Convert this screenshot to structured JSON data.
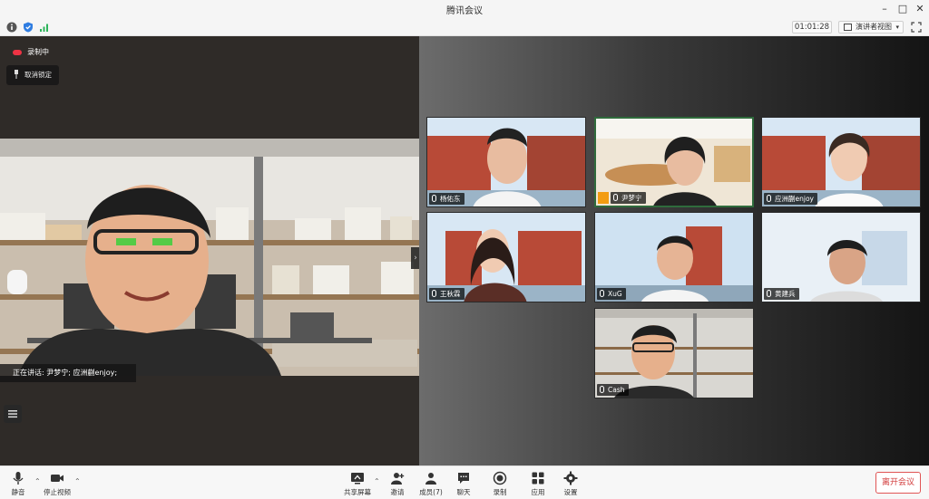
{
  "window": {
    "title": "腾讯会议"
  },
  "infobar": {
    "timer": "01:01:28",
    "view_mode": "演讲者视图"
  },
  "recording": {
    "label": "录制中"
  },
  "unpin": {
    "label": "取消锁定"
  },
  "speaking": {
    "label": "正在讲话: 尹梦宁; 应洲蒯enjoy;"
  },
  "participants": [
    {
      "name": "杨佑东"
    },
    {
      "name": "尹梦宁"
    },
    {
      "name": "应洲蒯enjoy"
    },
    {
      "name": "王秋霖"
    },
    {
      "name": "XuG"
    },
    {
      "name": "黄建兵"
    },
    {
      "name": "Cash"
    }
  ],
  "toolbar": {
    "mute": "静音",
    "stop_video": "停止视频",
    "share": "共享屏幕",
    "invite": "邀请",
    "members": "成员(7)",
    "chat": "聊天",
    "record": "录制",
    "apps": "应用",
    "settings": "设置",
    "leave": "离开会议"
  },
  "colors": {
    "leave": "#d23b3b",
    "active_tile": "#2f6b3c",
    "recording": "#e33344"
  }
}
